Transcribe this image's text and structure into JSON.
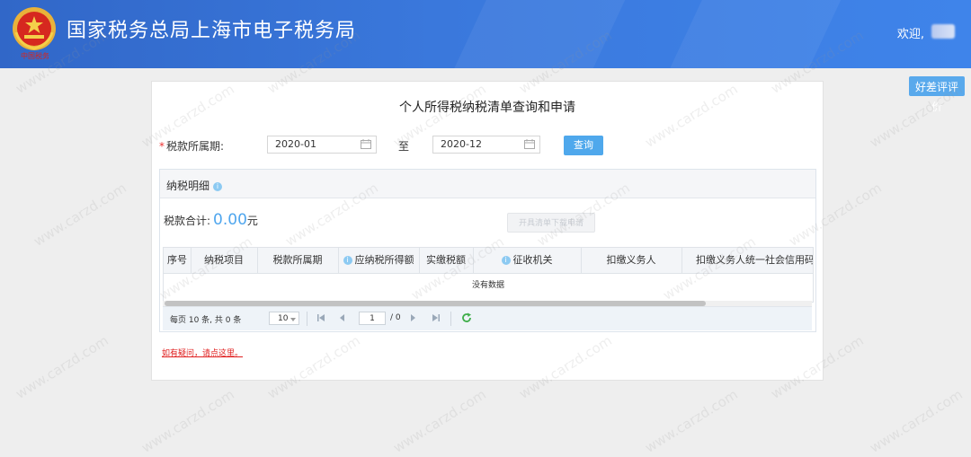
{
  "header": {
    "site_title": "国家税务总局上海市电子税务局",
    "emblem_caption": "中国税务",
    "welcome": "欢迎,"
  },
  "rating_button": "好差评评价",
  "page": {
    "title": "个人所得税纳税清单查询和申请",
    "period_label": "税款所属期:",
    "start_date": "2020-01",
    "to_label": "至",
    "end_date": "2020-12",
    "query_button": "查询"
  },
  "detail": {
    "title": "纳税明细",
    "total_label": "税款合计:",
    "total_amount": "0.00",
    "total_unit": "元",
    "ghost_button": "开具清单下载申请",
    "columns": [
      "序号",
      "纳税项目",
      "税款所属期",
      "应纳税所得额",
      "实缴税额",
      "征收机关",
      "扣缴义务人",
      "扣缴义务人统一社会信用码"
    ],
    "no_data": "没有数据",
    "pager": {
      "summary": "每页 10 条, 共 0 条",
      "page_size": "10",
      "current_page": "1",
      "total_pages": "/ 0"
    }
  },
  "help_link": "如有疑问，请点这里。",
  "watermark": "www.carzd.com",
  "colors": {
    "header_blue": "#3a78dc",
    "button_blue": "#4fa8ec",
    "amount_blue": "#4fa6ee",
    "link_red": "#e02020"
  }
}
